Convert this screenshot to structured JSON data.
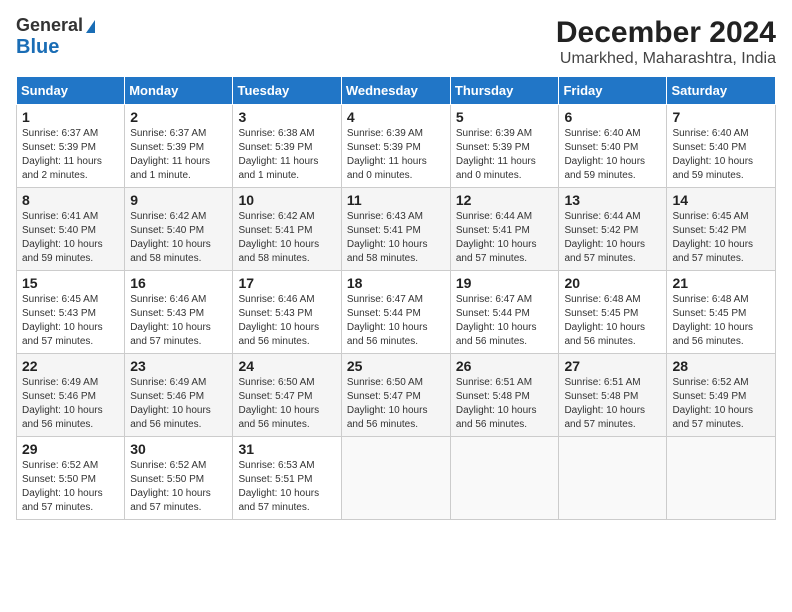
{
  "logo": {
    "line1": "General",
    "line2": "Blue"
  },
  "title": "December 2024",
  "subtitle": "Umarkhed, Maharashtra, India",
  "weekdays": [
    "Sunday",
    "Monday",
    "Tuesday",
    "Wednesday",
    "Thursday",
    "Friday",
    "Saturday"
  ],
  "weeks": [
    [
      {
        "day": "1",
        "detail": "Sunrise: 6:37 AM\nSunset: 5:39 PM\nDaylight: 11 hours and 2 minutes."
      },
      {
        "day": "2",
        "detail": "Sunrise: 6:37 AM\nSunset: 5:39 PM\nDaylight: 11 hours and 1 minute."
      },
      {
        "day": "3",
        "detail": "Sunrise: 6:38 AM\nSunset: 5:39 PM\nDaylight: 11 hours and 1 minute."
      },
      {
        "day": "4",
        "detail": "Sunrise: 6:39 AM\nSunset: 5:39 PM\nDaylight: 11 hours and 0 minutes."
      },
      {
        "day": "5",
        "detail": "Sunrise: 6:39 AM\nSunset: 5:39 PM\nDaylight: 11 hours and 0 minutes."
      },
      {
        "day": "6",
        "detail": "Sunrise: 6:40 AM\nSunset: 5:40 PM\nDaylight: 10 hours and 59 minutes."
      },
      {
        "day": "7",
        "detail": "Sunrise: 6:40 AM\nSunset: 5:40 PM\nDaylight: 10 hours and 59 minutes."
      }
    ],
    [
      {
        "day": "8",
        "detail": "Sunrise: 6:41 AM\nSunset: 5:40 PM\nDaylight: 10 hours and 59 minutes."
      },
      {
        "day": "9",
        "detail": "Sunrise: 6:42 AM\nSunset: 5:40 PM\nDaylight: 10 hours and 58 minutes."
      },
      {
        "day": "10",
        "detail": "Sunrise: 6:42 AM\nSunset: 5:41 PM\nDaylight: 10 hours and 58 minutes."
      },
      {
        "day": "11",
        "detail": "Sunrise: 6:43 AM\nSunset: 5:41 PM\nDaylight: 10 hours and 58 minutes."
      },
      {
        "day": "12",
        "detail": "Sunrise: 6:44 AM\nSunset: 5:41 PM\nDaylight: 10 hours and 57 minutes."
      },
      {
        "day": "13",
        "detail": "Sunrise: 6:44 AM\nSunset: 5:42 PM\nDaylight: 10 hours and 57 minutes."
      },
      {
        "day": "14",
        "detail": "Sunrise: 6:45 AM\nSunset: 5:42 PM\nDaylight: 10 hours and 57 minutes."
      }
    ],
    [
      {
        "day": "15",
        "detail": "Sunrise: 6:45 AM\nSunset: 5:43 PM\nDaylight: 10 hours and 57 minutes."
      },
      {
        "day": "16",
        "detail": "Sunrise: 6:46 AM\nSunset: 5:43 PM\nDaylight: 10 hours and 57 minutes."
      },
      {
        "day": "17",
        "detail": "Sunrise: 6:46 AM\nSunset: 5:43 PM\nDaylight: 10 hours and 56 minutes."
      },
      {
        "day": "18",
        "detail": "Sunrise: 6:47 AM\nSunset: 5:44 PM\nDaylight: 10 hours and 56 minutes."
      },
      {
        "day": "19",
        "detail": "Sunrise: 6:47 AM\nSunset: 5:44 PM\nDaylight: 10 hours and 56 minutes."
      },
      {
        "day": "20",
        "detail": "Sunrise: 6:48 AM\nSunset: 5:45 PM\nDaylight: 10 hours and 56 minutes."
      },
      {
        "day": "21",
        "detail": "Sunrise: 6:48 AM\nSunset: 5:45 PM\nDaylight: 10 hours and 56 minutes."
      }
    ],
    [
      {
        "day": "22",
        "detail": "Sunrise: 6:49 AM\nSunset: 5:46 PM\nDaylight: 10 hours and 56 minutes."
      },
      {
        "day": "23",
        "detail": "Sunrise: 6:49 AM\nSunset: 5:46 PM\nDaylight: 10 hours and 56 minutes."
      },
      {
        "day": "24",
        "detail": "Sunrise: 6:50 AM\nSunset: 5:47 PM\nDaylight: 10 hours and 56 minutes."
      },
      {
        "day": "25",
        "detail": "Sunrise: 6:50 AM\nSunset: 5:47 PM\nDaylight: 10 hours and 56 minutes."
      },
      {
        "day": "26",
        "detail": "Sunrise: 6:51 AM\nSunset: 5:48 PM\nDaylight: 10 hours and 56 minutes."
      },
      {
        "day": "27",
        "detail": "Sunrise: 6:51 AM\nSunset: 5:48 PM\nDaylight: 10 hours and 57 minutes."
      },
      {
        "day": "28",
        "detail": "Sunrise: 6:52 AM\nSunset: 5:49 PM\nDaylight: 10 hours and 57 minutes."
      }
    ],
    [
      {
        "day": "29",
        "detail": "Sunrise: 6:52 AM\nSunset: 5:50 PM\nDaylight: 10 hours and 57 minutes."
      },
      {
        "day": "30",
        "detail": "Sunrise: 6:52 AM\nSunset: 5:50 PM\nDaylight: 10 hours and 57 minutes."
      },
      {
        "day": "31",
        "detail": "Sunrise: 6:53 AM\nSunset: 5:51 PM\nDaylight: 10 hours and 57 minutes."
      },
      null,
      null,
      null,
      null
    ]
  ]
}
